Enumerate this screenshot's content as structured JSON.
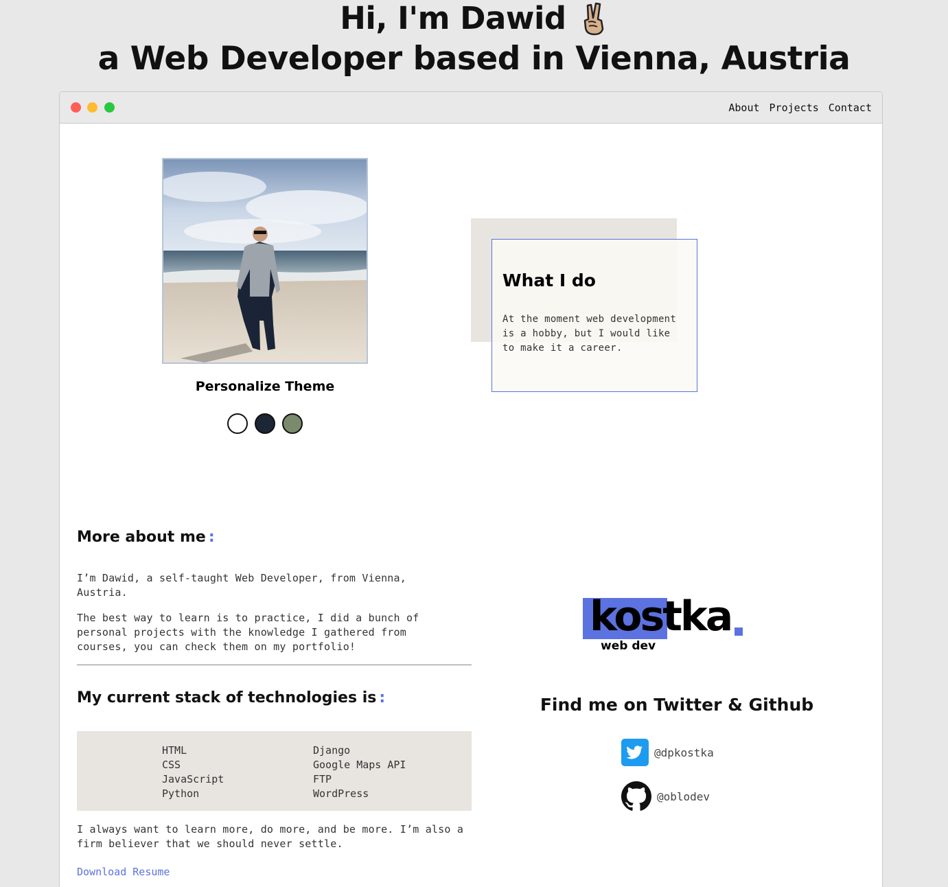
{
  "hero": {
    "line1": "Hi, I'm Dawid",
    "line2": "a Web Developer based in Vienna, Austria",
    "emoji_icon": "victory-hand-emoji"
  },
  "nav": {
    "items": [
      "About",
      "Projects",
      "Contact"
    ]
  },
  "window_controls": {
    "close": "#fd5f57",
    "minimize": "#fdbc2e",
    "maximize": "#28c840"
  },
  "profile": {
    "theme_title": "Personalize Theme",
    "swatches": [
      {
        "name": "light",
        "color": "#ffffff"
      },
      {
        "name": "dark",
        "color": "#1c2634"
      },
      {
        "name": "green",
        "color": "#7a8a6c"
      }
    ]
  },
  "what_i_do": {
    "title": "What I do",
    "text": "At the moment web development is a hobby, but I would like to make it a career."
  },
  "about": {
    "heading": "More about me",
    "p1": "I’m Dawid, a self-taught Web Developer, from Vienna, Austria.",
    "p2": "The best way to learn is to practice, I did a bunch of personal projects with the knowledge I gathered from courses, you can check them on my portfolio!"
  },
  "stack": {
    "heading": "My current stack of technologies is",
    "col1": [
      "HTML",
      "CSS",
      "JavaScript",
      "Python"
    ],
    "col2": [
      "Django",
      "Google Maps API",
      "FTP",
      "WordPress"
    ]
  },
  "outro": {
    "text": "I always want to learn more, do more, and be more. I’m also a firm believer that we should never settle.",
    "download": "Download Resume"
  },
  "logo": {
    "word": "kostka",
    "sub": "web dev"
  },
  "social": {
    "heading": "Find me on Twitter & Github",
    "twitter": "@dpkostka",
    "github": "@oblodev"
  },
  "colors": {
    "accent": "#5b72e0",
    "card_bg": "#e8e5e0",
    "page_bg": "#e8e8e8"
  }
}
